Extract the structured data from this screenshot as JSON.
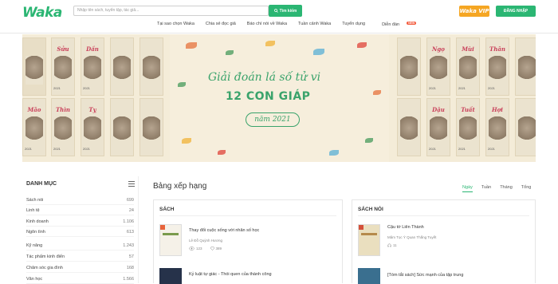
{
  "header": {
    "logo": "Waka",
    "search_placeholder": "Nhập tên sách, tuyển tập, tác giả...",
    "search_button": "Tìm kiếm",
    "vip_label": "Waka VIP",
    "login_label": "ĐĂNG NHẬP"
  },
  "nav": {
    "items": [
      "Tại sao chọn Waka",
      "Chia sẻ đọc giả",
      "Báo chí nói về Waka",
      "Tuần cảnh Waka",
      "Tuyển dụng",
      "Diễn đàn"
    ],
    "badge": "NEW"
  },
  "banner": {
    "headline_line1": "Giải đoán lá số tử vi",
    "headline_line2": "12 CON GIÁP",
    "ribbon": "năm 2021",
    "cards_left": [
      "Sửu",
      "Dần",
      "Mão",
      "Thìn",
      "Tỵ"
    ],
    "cards_right": [
      "Ngọ",
      "Mùi",
      "Thân",
      "Dậu",
      "Tuất",
      "Hợi"
    ],
    "card_year": "2021"
  },
  "sidebar": {
    "title": "DANH MỤC",
    "categories": [
      {
        "name": "Sách nói",
        "count": "699"
      },
      {
        "name": "Linh tệ",
        "count": "24"
      },
      {
        "name": "Kinh doanh",
        "count": "1.106"
      },
      {
        "name": "Ngôn tình",
        "count": "613"
      },
      {
        "name": "Kỹ năng",
        "count": "1.243"
      },
      {
        "name": "Tác phẩm kinh điển",
        "count": "57"
      },
      {
        "name": "Chăm sóc gia đình",
        "count": "168"
      },
      {
        "name": "Văn học",
        "count": "1.566"
      }
    ]
  },
  "ranking": {
    "title": "Bảng xếp hạng",
    "tabs": [
      "Ngày",
      "Tuần",
      "Tháng",
      "Tổng"
    ],
    "active_tab": "Ngày",
    "books_panel": {
      "title": "SÁCH",
      "items": [
        {
          "title": "Thay đổi cuộc sống với nhân số học",
          "author": "Lê Đỗ Quỳnh Hương",
          "views": "123",
          "likes": "389"
        },
        {
          "title": "Kỷ luật tự giác - Thói quen của thành công",
          "author": "",
          "views": "",
          "likes": ""
        }
      ]
    },
    "audio_panel": {
      "title": "SÁCH NÓI",
      "items": [
        {
          "title": "Cậu tớ Liên Thành",
          "author": "Mâm Tọc Ý Quan Thắng Tuyết",
          "views": "11",
          "likes": ""
        },
        {
          "title": "[Tóm tắt sách] Sức mạnh của tập trung",
          "author": "",
          "views": "",
          "likes": ""
        }
      ]
    }
  },
  "colors": {
    "brand": "#2bb673",
    "vip": "#f5a623",
    "badge": "#f35b3d"
  }
}
